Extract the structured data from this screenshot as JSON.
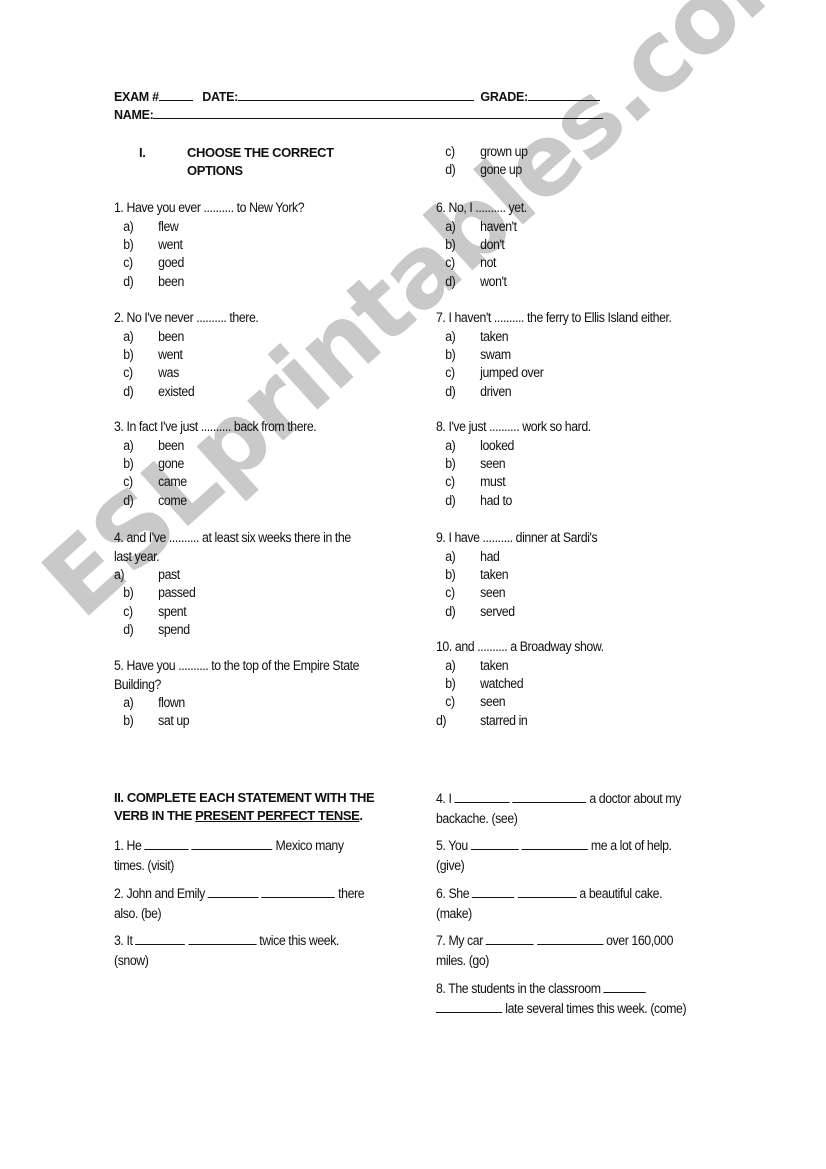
{
  "header": {
    "exam_label": "EXAM  #",
    "date_label": "DATE:",
    "grade_label": "GRADE:",
    "name_label": "NAME:"
  },
  "section1": {
    "numeral": "I.",
    "title_line1": "CHOOSE THE CORRECT",
    "title_line2": "OPTIONS",
    "questions": [
      {
        "stem": "1. Have you ever .......... to New York?",
        "options": [
          {
            "label": "a)",
            "text": "flew"
          },
          {
            "label": "b)",
            "text": "went"
          },
          {
            "label": "c)",
            "text": "goed"
          },
          {
            "label": "d)",
            "text": "been"
          }
        ]
      },
      {
        "stem": "2. No I've never .......... there.",
        "options": [
          {
            "label": "a)",
            "text": "been"
          },
          {
            "label": "b)",
            "text": "went"
          },
          {
            "label": "c)",
            "text": "was"
          },
          {
            "label": "d)",
            "text": "existed"
          }
        ]
      },
      {
        "stem": "3. In fact I've just .......... back from there.",
        "options": [
          {
            "label": "a)",
            "text": "been"
          },
          {
            "label": "b)",
            "text": "gone"
          },
          {
            "label": "c)",
            "text": "came"
          },
          {
            "label": "d)",
            "text": "come"
          }
        ]
      },
      {
        "stem": "4. and I've .......... at least six weeks there in the",
        "stem2": "last year.",
        "options": [
          {
            "label": "a)",
            "text": "past"
          },
          {
            "label": "b)",
            "text": "passed"
          },
          {
            "label": "c)",
            "text": "spent"
          },
          {
            "label": "d)",
            "text": "spend"
          }
        ]
      },
      {
        "stem": "5. Have you .......... to the top of the Empire State",
        "stem2": "Building?",
        "options": [
          {
            "label": "a)",
            "text": "flown"
          },
          {
            "label": "b)",
            "text": "sat up"
          },
          {
            "label": "c)",
            "text": "grown up"
          },
          {
            "label": "d)",
            "text": "gone up"
          }
        ]
      },
      {
        "stem": "6. No, I .......... yet.",
        "options": [
          {
            "label": "a)",
            "text": "haven't"
          },
          {
            "label": "b)",
            "text": "don't"
          },
          {
            "label": "c)",
            "text": "not"
          },
          {
            "label": "d)",
            "text": "won't"
          }
        ]
      },
      {
        "stem": "7. I haven't .......... the ferry to Ellis Island either.",
        "options": [
          {
            "label": "a)",
            "text": "taken"
          },
          {
            "label": "b)",
            "text": "swam"
          },
          {
            "label": "c)",
            "text": "jumped over"
          },
          {
            "label": "d)",
            "text": "driven"
          }
        ]
      },
      {
        "stem": "8. I've just .......... work so hard.",
        "options": [
          {
            "label": "a)",
            "text": "looked"
          },
          {
            "label": "b)",
            "text": "seen"
          },
          {
            "label": "c)",
            "text": "must"
          },
          {
            "label": "d)",
            "text": "had to"
          }
        ]
      },
      {
        "stem": "9. I have .......... dinner at Sardi's",
        "options": [
          {
            "label": "a)",
            "text": "had"
          },
          {
            "label": "b)",
            "text": "taken"
          },
          {
            "label": "c)",
            "text": "seen"
          },
          {
            "label": "d)",
            "text": "served"
          }
        ]
      },
      {
        "stem": "10. and .......... a Broadway show.",
        "options": [
          {
            "label": "a)",
            "text": "taken"
          },
          {
            "label": "b)",
            "text": "watched"
          },
          {
            "label": "c)",
            "text": "seen"
          },
          {
            "label": "d)",
            "text": "starred in"
          }
        ]
      }
    ]
  },
  "section2": {
    "title_part1": "II.   COMPLETE EACH STATEMENT WITH THE",
    "title_part2a": "VERB IN THE ",
    "title_part2b": "PRESENT PERFECT TENSE",
    "title_part2c": ".",
    "items": [
      {
        "pre": "1. He",
        "post": "Mexico many",
        "line2": "times. (visit)"
      },
      {
        "pre": "2. John and Emily",
        "post": "there",
        "line2": "also. (be)"
      },
      {
        "pre": "3. It",
        "post": "twice this week.",
        "line2": "(snow)"
      },
      {
        "pre": "4. I",
        "post": "a doctor about my",
        "line2": "backache. (see)"
      },
      {
        "pre": "5. You",
        "post": "me a lot of help.",
        "line2": "(give)"
      },
      {
        "pre": "6. She",
        "post": "a beautiful cake.",
        "line2": "(make)"
      },
      {
        "pre": "7. My car",
        "post": "over 160,000",
        "line2": "miles. (go)"
      },
      {
        "pre": "8. The students in the classroom",
        "post": "late several times this week. (come)"
      }
    ]
  },
  "watermark": {
    "text": "ESLprintables.com",
    "color": "#c9c9c9"
  }
}
